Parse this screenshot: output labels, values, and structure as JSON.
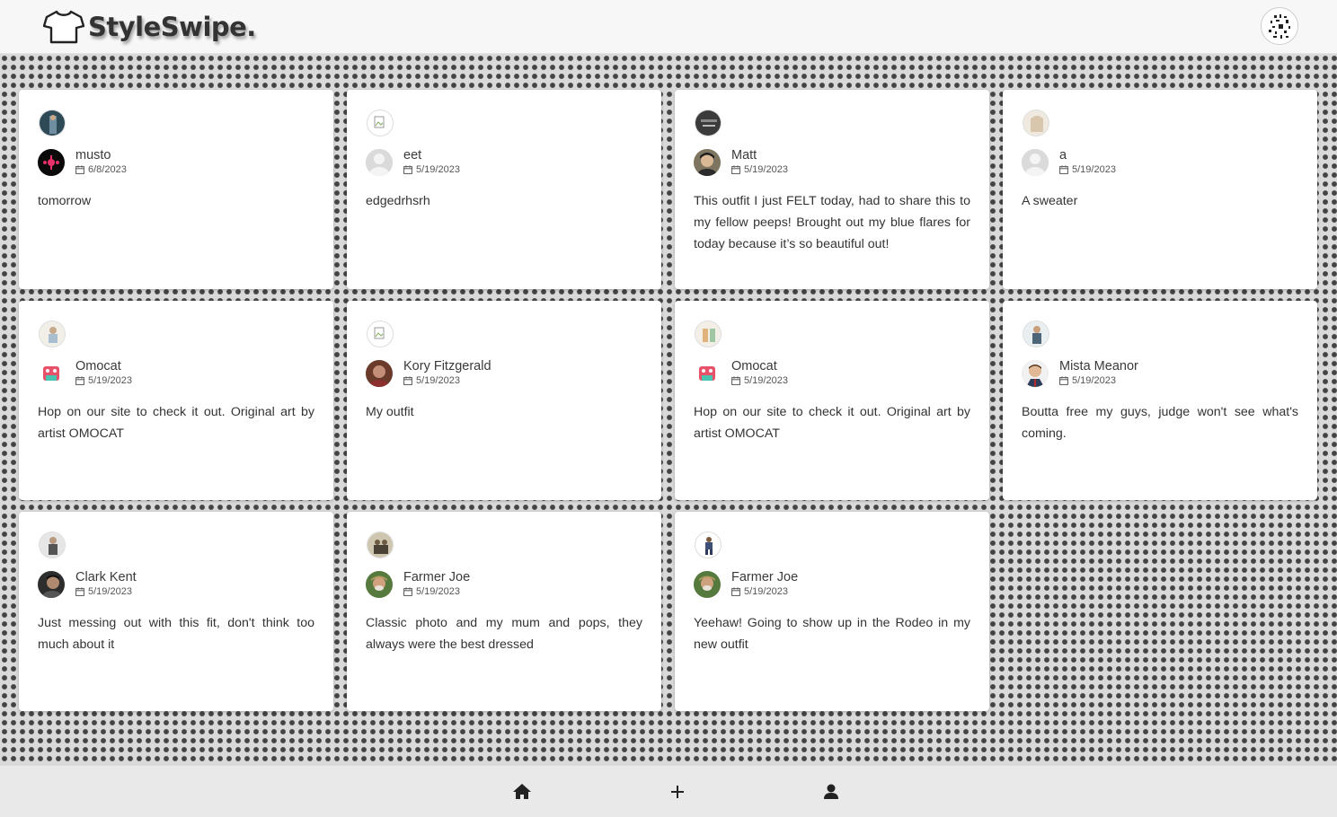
{
  "app": {
    "name": "StyleSwipe."
  },
  "header": {
    "logo_icon": "tshirt-icon",
    "avatar": "profile-avatar"
  },
  "posts": [
    {
      "user": "musto",
      "date": "6/8/2023",
      "caption": "tomorrow"
    },
    {
      "user": "eet",
      "date": "5/19/2023",
      "caption": "edgedrhsrh"
    },
    {
      "user": "Matt",
      "date": "5/19/2023",
      "caption": "This outfit I just FELT today, had to share this to my fellow peeps! Brought out my blue flares for today because it’s so beautiful out!"
    },
    {
      "user": "a",
      "date": "5/19/2023",
      "caption": "A sweater"
    },
    {
      "user": "Omocat",
      "date": "5/19/2023",
      "caption": "Hop on our site to check it out. Original art by artist OMOCAT"
    },
    {
      "user": "Kory Fitzgerald",
      "date": "5/19/2023",
      "caption": "My outfit"
    },
    {
      "user": "Omocat",
      "date": "5/19/2023",
      "caption": "Hop on our site to check it out. Original art by artist OMOCAT"
    },
    {
      "user": "Mista Meanor",
      "date": "5/19/2023",
      "caption": "Boutta free my guys, judge won't see what's coming."
    },
    {
      "user": "Clark Kent",
      "date": "5/19/2023",
      "caption": "Just messing out with this fit, don't think too much about it"
    },
    {
      "user": "Farmer Joe",
      "date": "5/19/2023",
      "caption": "Classic photo and my mum and pops, they always were the best dressed"
    },
    {
      "user": "Farmer Joe",
      "date": "5/19/2023",
      "caption": "Yeehaw! Going to show up in the Rodeo in my new outfit"
    }
  ],
  "bottom_nav": {
    "items": [
      {
        "icon": "home-icon"
      },
      {
        "icon": "plus-icon"
      },
      {
        "icon": "user-icon"
      }
    ]
  },
  "colors": {
    "text": "#333333",
    "nav_bg": "#e9e9e9",
    "header_bg": "#f7f7f7"
  }
}
